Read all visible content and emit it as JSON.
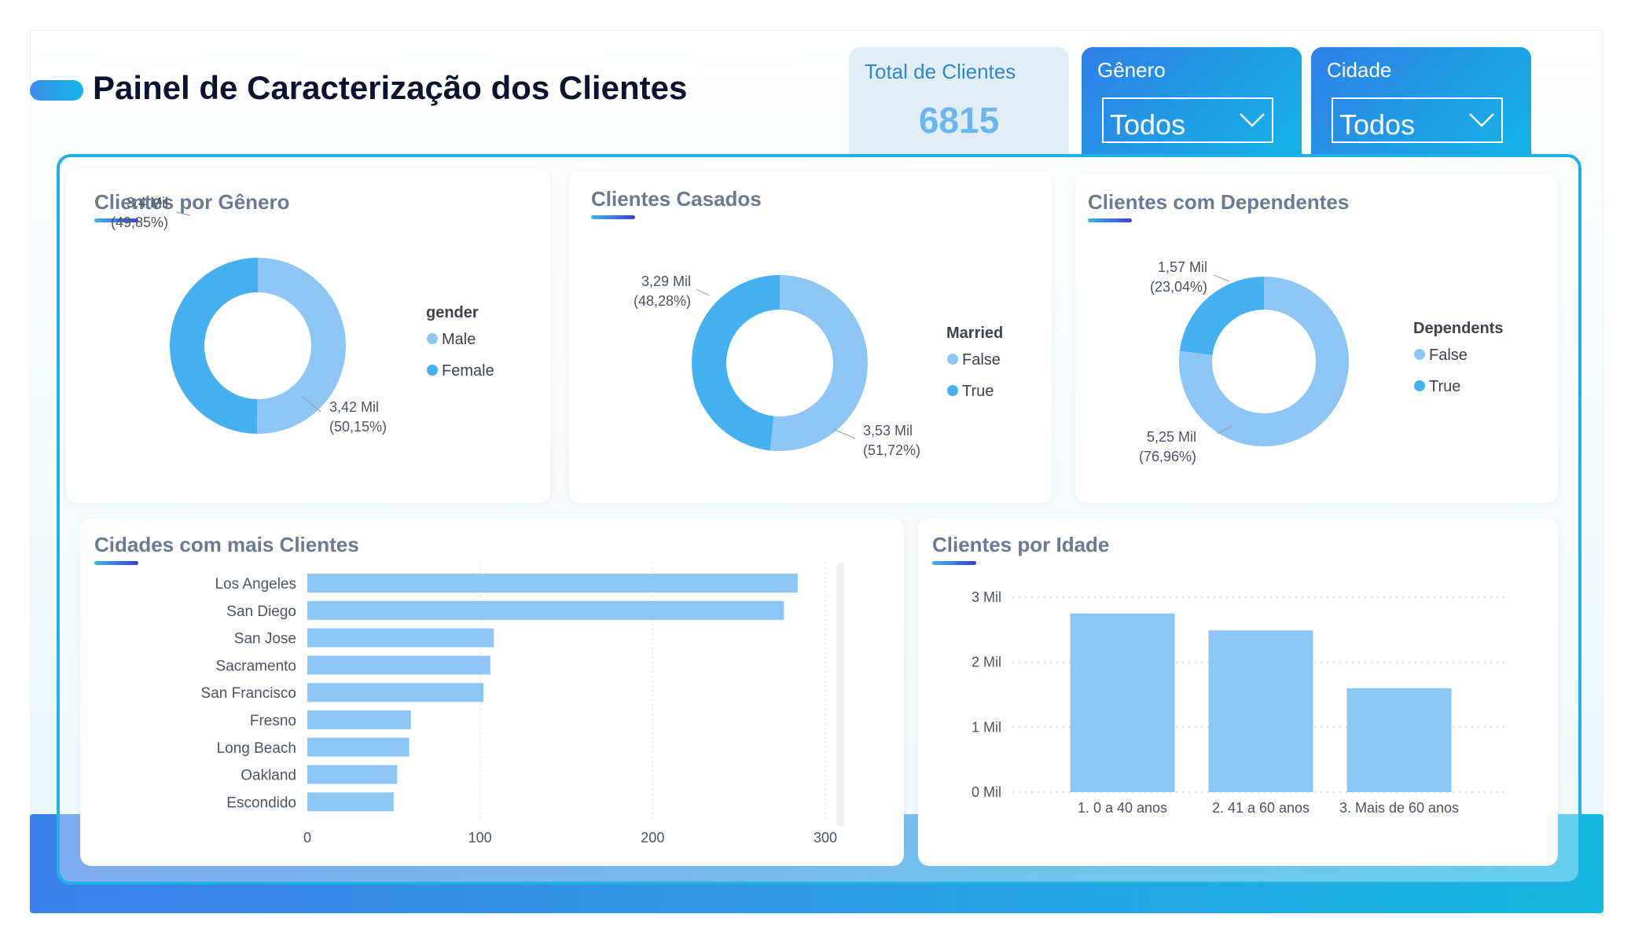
{
  "page_title": "Painel de Caracterização dos Clientes",
  "kpis": {
    "total": {
      "label": "Total de Clientes",
      "value": "6815"
    },
    "genero": {
      "label": "Gênero",
      "selected": "Todos"
    },
    "cidade": {
      "label": "Cidade",
      "selected": "Todos"
    }
  },
  "cards": {
    "genero": {
      "title": "Clientes por Gênero"
    },
    "casados": {
      "title": "Clientes Casados"
    },
    "dependentes": {
      "title": "Clientes com Dependentes"
    },
    "cidades": {
      "title": "Cidades com mais Clientes"
    },
    "idade": {
      "title": "Clientes por Idade"
    }
  },
  "colors": {
    "light": "#8dc6f4",
    "dark": "#45b0f0",
    "accent": "#1fb1e4"
  },
  "chart_data": [
    {
      "type": "pie",
      "title": "Clientes por Gênero",
      "legend_title": "gender",
      "legend_position": "right",
      "slices": [
        {
          "name": "Male",
          "value": 3.42,
          "label": "3,42 Mil",
          "pct": "(50,15%)"
        },
        {
          "name": "Female",
          "value": 3.4,
          "label": "3,4 Mil",
          "pct": "(49,85%)"
        }
      ]
    },
    {
      "type": "pie",
      "title": "Clientes Casados",
      "legend_title": "Married",
      "legend_position": "right",
      "slices": [
        {
          "name": "False",
          "value": 3.53,
          "label": "3,53 Mil",
          "pct": "(51,72%)"
        },
        {
          "name": "True",
          "value": 3.29,
          "label": "3,29 Mil",
          "pct": "(48,28%)"
        }
      ]
    },
    {
      "type": "pie",
      "title": "Clientes com Dependentes",
      "legend_title": "Dependents",
      "legend_position": "right",
      "slices": [
        {
          "name": "False",
          "value": 5.25,
          "label": "5,25 Mil",
          "pct": "(76,96%)"
        },
        {
          "name": "True",
          "value": 1.57,
          "label": "1,57 Mil",
          "pct": "(23,04%)"
        }
      ]
    },
    {
      "type": "bar",
      "orientation": "horizontal",
      "title": "Cidades com mais Clientes",
      "categories": [
        "Los Angeles",
        "San Diego",
        "San Jose",
        "Sacramento",
        "San Francisco",
        "Fresno",
        "Long Beach",
        "Oakland",
        "Escondido"
      ],
      "values": [
        284,
        276,
        108,
        106,
        102,
        60,
        59,
        52,
        50
      ],
      "xlim": [
        0,
        300
      ],
      "xticks": [
        "0",
        "100",
        "200",
        "300"
      ],
      "grid": true
    },
    {
      "type": "bar",
      "orientation": "vertical",
      "title": "Clientes por Idade",
      "categories": [
        "1. 0 a 40 anos",
        "2. 41 a 60 anos",
        "3. Mais de 60 anos"
      ],
      "values": [
        2.75,
        2.49,
        1.6
      ],
      "ylim": [
        0,
        3
      ],
      "yticks": [
        "0 Mil",
        "1 Mil",
        "2 Mil",
        "3 Mil"
      ],
      "grid": true
    }
  ]
}
